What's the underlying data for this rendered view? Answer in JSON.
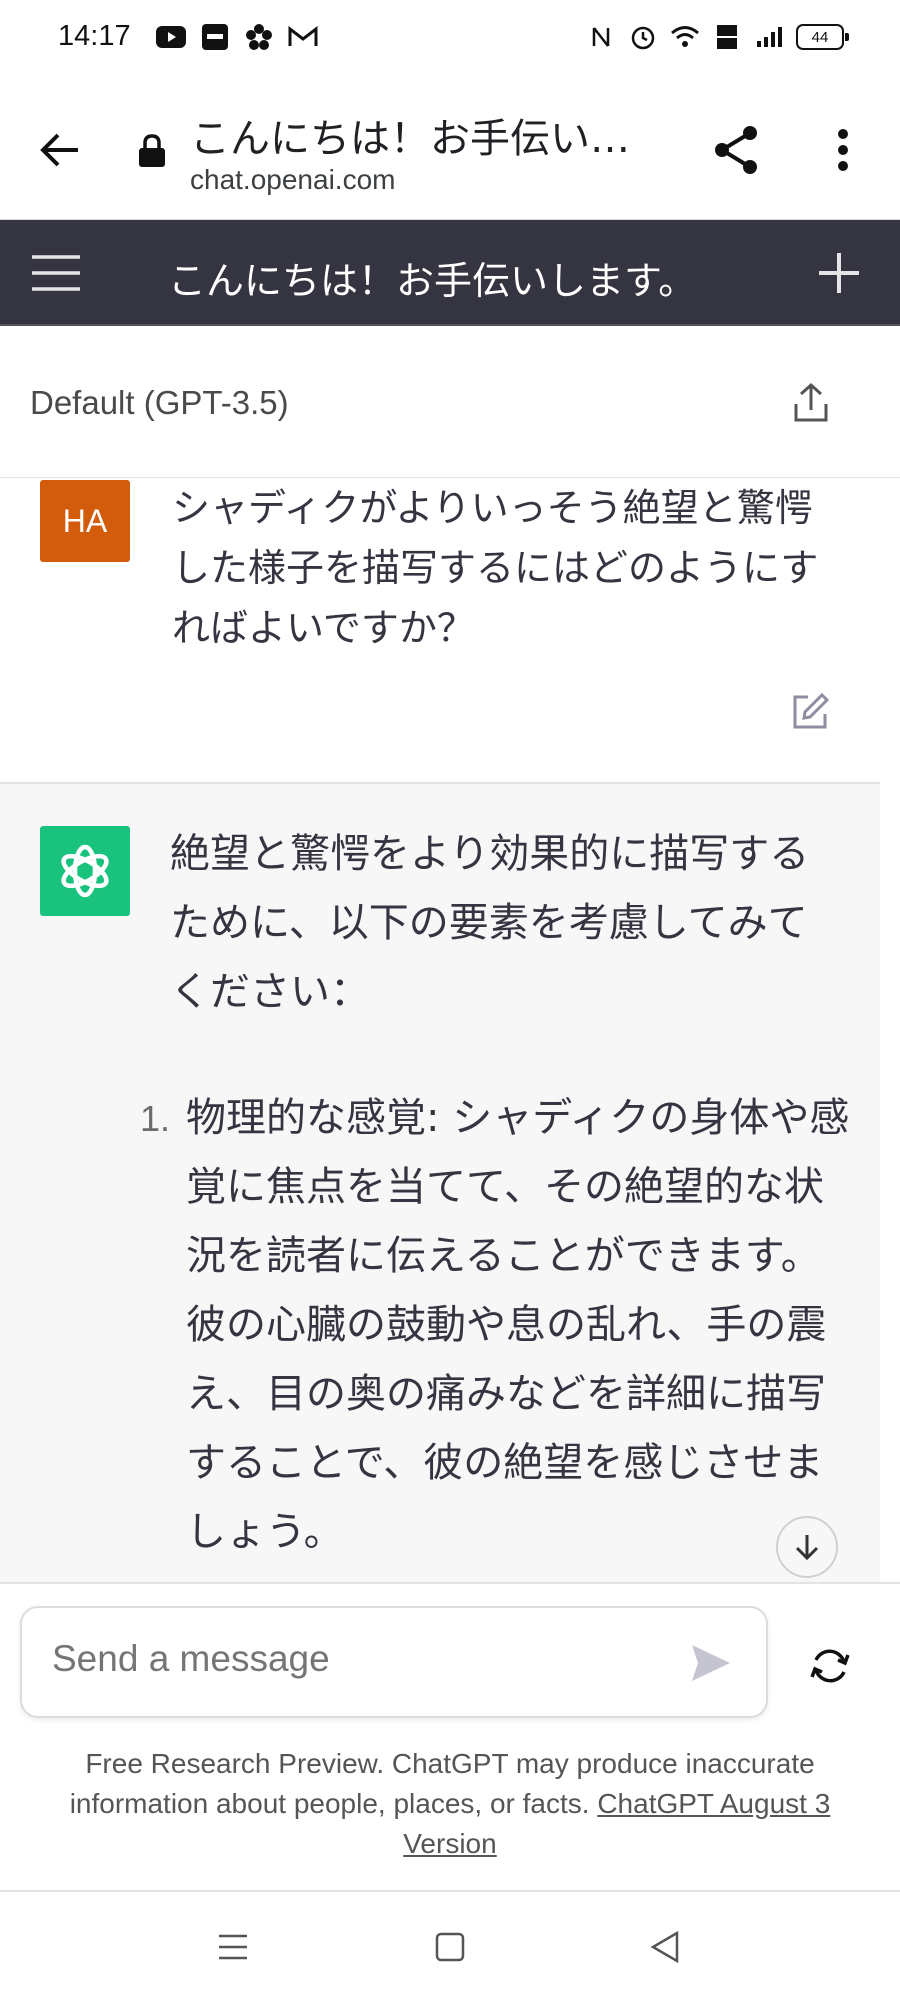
{
  "status_bar": {
    "time": "14:17",
    "battery": "44",
    "left_icons": [
      "youtube-icon",
      "muji-icon",
      "flower-app-icon",
      "gmail-icon"
    ],
    "right_icons": [
      "nfc-icon",
      "alarm-icon",
      "wifi-icon",
      "volte-icon",
      "signal-icon",
      "battery-icon"
    ]
  },
  "browser": {
    "page_title": "こんにちは！お手伝い…",
    "domain": "chat.openai.com"
  },
  "app_header": {
    "title": "こんにちは！お手伝いします。"
  },
  "model_bar": {
    "model": "Default (GPT-3.5)"
  },
  "conversation": {
    "user": {
      "avatar": "HA",
      "text": "シャディクがよりいっそう絶望と驚愕した様子を描写するにはどのようにすればよいですか？"
    },
    "assistant": {
      "intro": "絶望と驚愕をより効果的に描写するために、以下の要素を考慮してみてください：",
      "list": [
        {
          "number": "1.",
          "text": "物理的な感覚: シャディクの身体や感覚に焦点を当てて、その絶望的な状況を読者に伝えることができます。彼の心臓の鼓動や息の乱れ、手の震え、目の奥の痛みなどを詳細に描写することで、彼の絶望を感じさせましょう。"
        }
      ]
    }
  },
  "composer": {
    "placeholder": "Send a message",
    "disclaimer": "Free Research Preview. ChatGPT may produce inaccurate information about people, places, or facts. ",
    "version_link": "ChatGPT August 3 Version"
  },
  "colors": {
    "header_bg": "#343541",
    "user_avatar": "#d25c0b",
    "bot_avatar": "#19c37d",
    "assistant_bg": "#f7f7f8"
  }
}
